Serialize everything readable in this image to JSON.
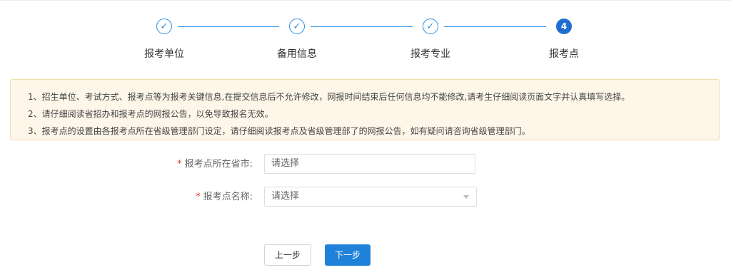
{
  "steps": [
    {
      "label": "报考单位",
      "status": "done",
      "icon": "check-icon"
    },
    {
      "label": "备用信息",
      "status": "done",
      "icon": "check-icon"
    },
    {
      "label": "报考专业",
      "status": "done",
      "icon": "check-icon"
    },
    {
      "label": "报考点",
      "status": "active",
      "number": "4"
    }
  ],
  "notice": {
    "lines": [
      "1、招生单位、考试方式、报考点等为报考关键信息,在提交信息后不允许修改，网报时间结束后任何信息均不能修改,请考生仔细阅读页面文字并认真填写选择。",
      "2、请仔细阅读省招办和报考点的网报公告，以免导致报名无效。",
      "3、报考点的设置由各报考点所在省级管理部门设定，请仔细阅读报考点及省级管理部了的网报公告，如有疑问请咨询省级管理部门。"
    ]
  },
  "form": {
    "required_mark": "*",
    "province": {
      "label": "报考点所在省市:",
      "value": "请选择"
    },
    "site": {
      "label": "报考点名称:",
      "value": "请选择"
    }
  },
  "buttons": {
    "prev": "上一步",
    "next": "下一步"
  },
  "colors": {
    "accent": "#1f82d8",
    "notice_bg": "#fdf6e9",
    "required": "#e63b2e"
  }
}
